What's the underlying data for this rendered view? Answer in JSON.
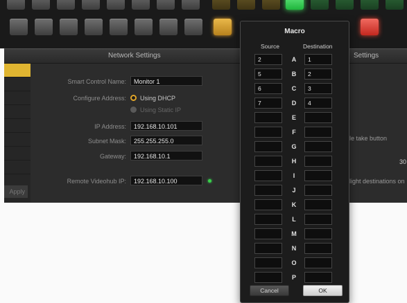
{
  "network_settings": {
    "title": "Network Settings",
    "smart_control_name": {
      "label": "Smart Control Name:",
      "value": "Monitor 1"
    },
    "configure_address": {
      "label": "Configure Address:",
      "options": [
        "Using DHCP",
        "Using Static IP"
      ],
      "selected": "Using DHCP"
    },
    "ip_address": {
      "label": "IP Address:",
      "value": "192.168.10.101"
    },
    "subnet_mask": {
      "label": "Subnet Mask:",
      "value": "255.255.255.0"
    },
    "gateway": {
      "label": "Gateway:",
      "value": "192.168.10.1"
    },
    "remote_videohub_ip": {
      "label": "Remote Videohub IP:",
      "value": "192.168.10.100"
    },
    "sidebar_button": "Apply"
  },
  "right_panel": {
    "title": "Settings",
    "take_button_text": "ble take button",
    "value_text": "30",
    "highlight_text": "hlight destinations on"
  },
  "macro": {
    "title": "Macro",
    "source_header": "Source",
    "destination_header": "Destination",
    "rows": [
      {
        "letter": "A",
        "source": "2",
        "destination": "1"
      },
      {
        "letter": "B",
        "source": "5",
        "destination": "2"
      },
      {
        "letter": "C",
        "source": "6",
        "destination": "3"
      },
      {
        "letter": "D",
        "source": "7",
        "destination": "4"
      },
      {
        "letter": "E",
        "source": "",
        "destination": ""
      },
      {
        "letter": "F",
        "source": "",
        "destination": ""
      },
      {
        "letter": "G",
        "source": "",
        "destination": ""
      },
      {
        "letter": "H",
        "source": "",
        "destination": ""
      },
      {
        "letter": "I",
        "source": "",
        "destination": ""
      },
      {
        "letter": "J",
        "source": "",
        "destination": ""
      },
      {
        "letter": "K",
        "source": "",
        "destination": ""
      },
      {
        "letter": "L",
        "source": "",
        "destination": ""
      },
      {
        "letter": "M",
        "source": "",
        "destination": ""
      },
      {
        "letter": "N",
        "source": "",
        "destination": ""
      },
      {
        "letter": "O",
        "source": "",
        "destination": ""
      },
      {
        "letter": "P",
        "source": "",
        "destination": ""
      }
    ],
    "cancel_label": "Cancel",
    "ok_label": "OK"
  },
  "colors": {
    "accent_amber": "#e0a52a",
    "status_green": "#39d04a",
    "active_red": "#c4281f"
  }
}
